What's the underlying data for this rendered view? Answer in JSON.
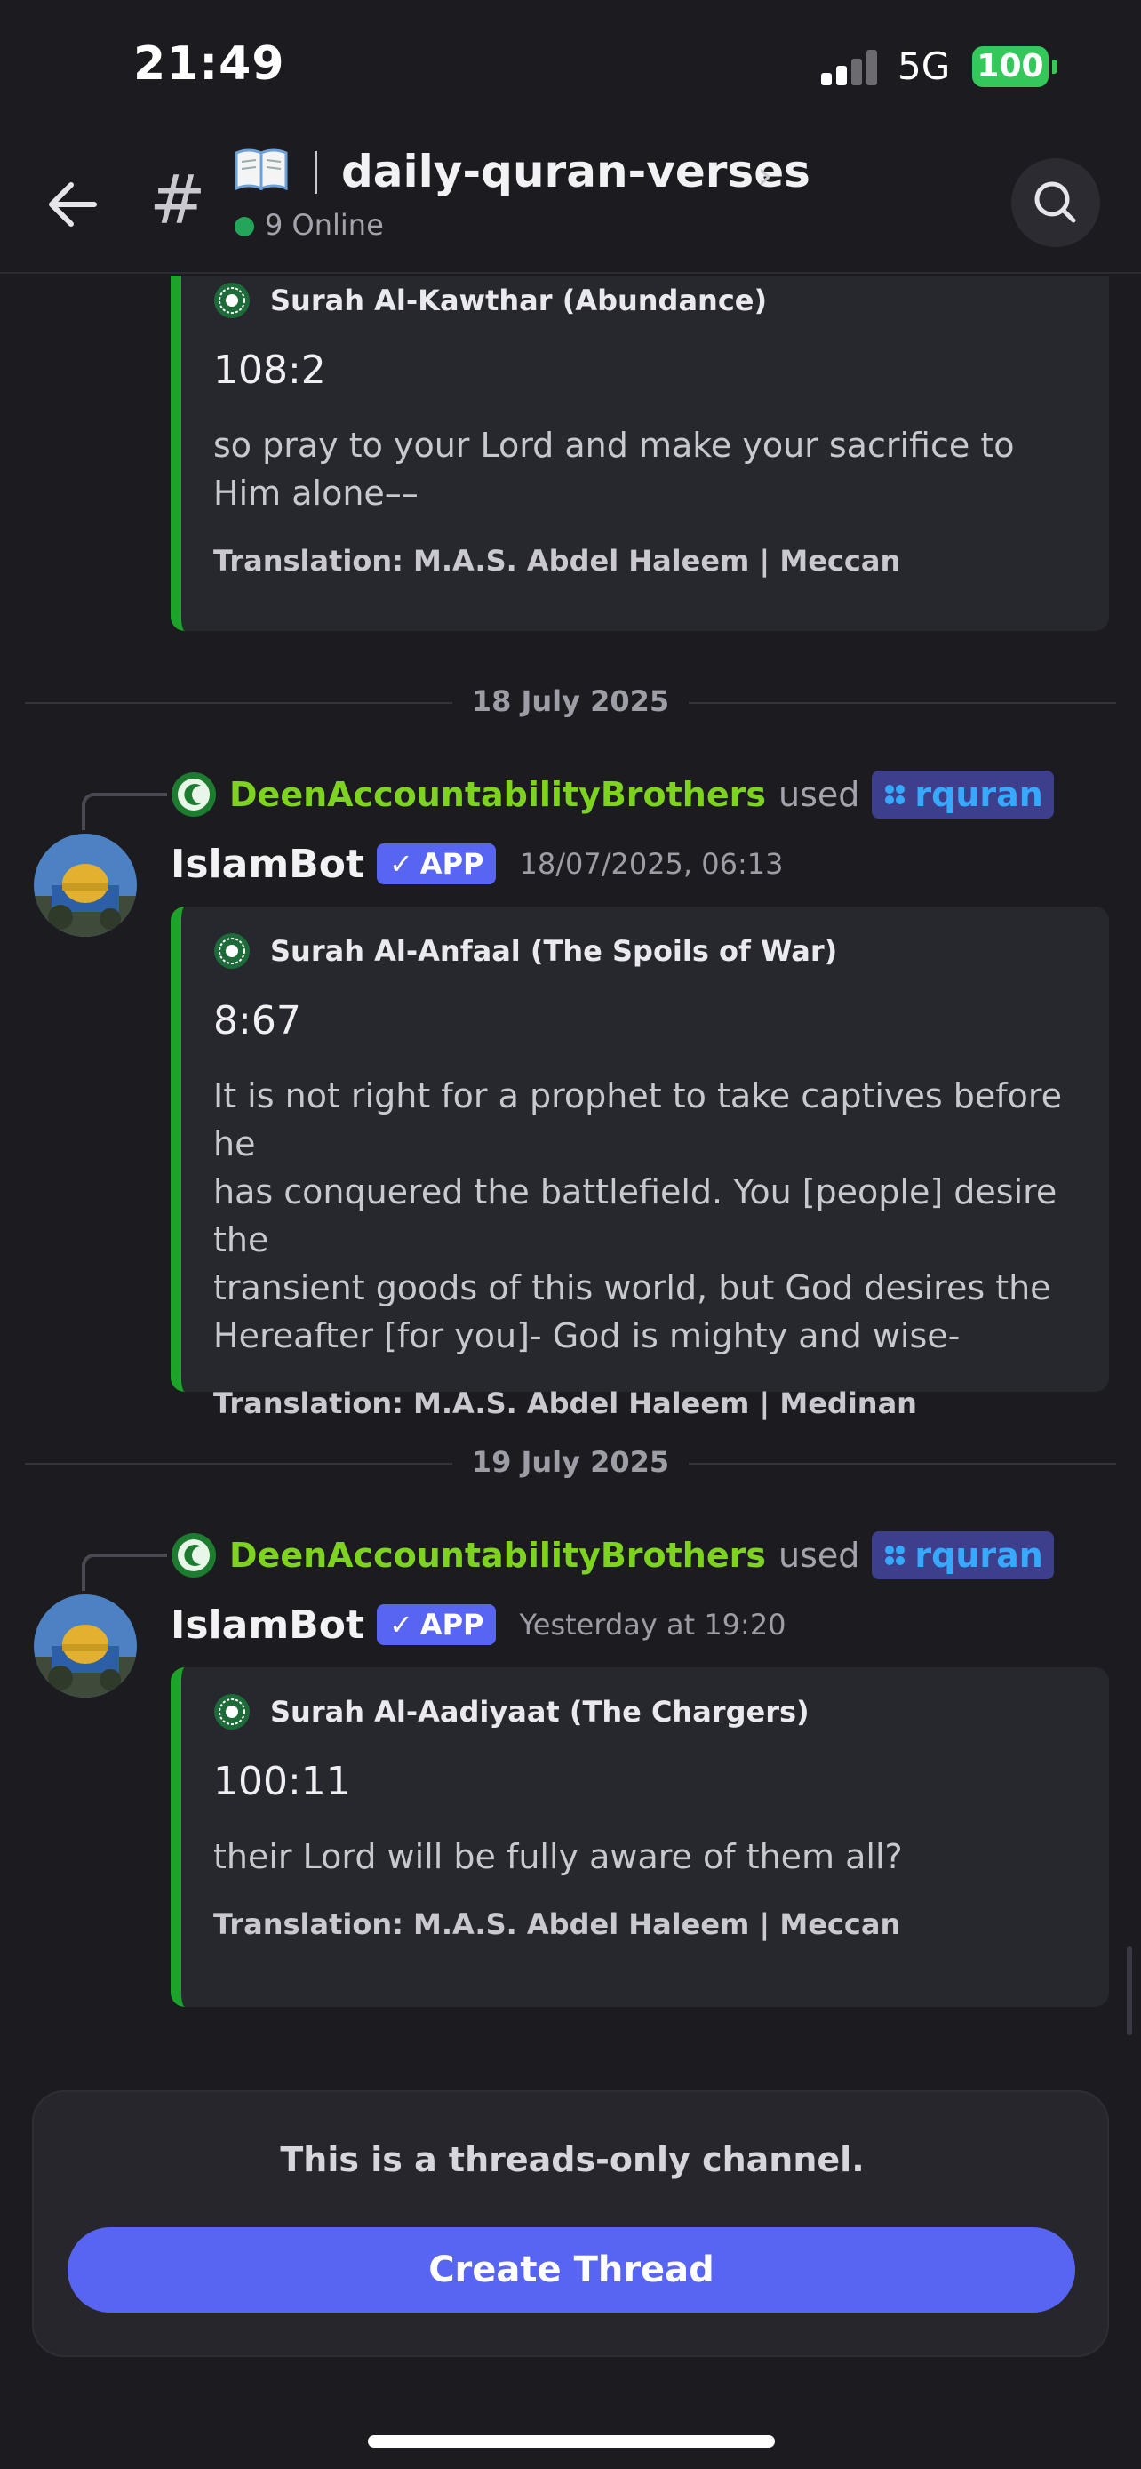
{
  "status_bar": {
    "time": "21:49",
    "network": "5G",
    "battery": "100"
  },
  "header": {
    "channel_emoji": "📖",
    "channel_name": "daily-quran-verses",
    "online_text": "9 Online",
    "icons": {
      "back": "arrow-left-icon",
      "channel": "hash-icon",
      "search": "search-icon",
      "chevron": "chevron-right-icon"
    }
  },
  "messages": [
    {
      "embed": {
        "author": "Surah Al-Kawthar (Abundance)",
        "verse": "108:2",
        "text": "so pray to your Lord and make your sacrifice to Him alone––",
        "footer": "Translation: M.A.S. Abdel Haleem | Meccan"
      }
    },
    {
      "date_separator": "18 July 2025",
      "reply_user": "DeenAccountabilityBrothers",
      "reply_used": "used",
      "command": "rquran",
      "bot_name": "IslamBot",
      "badge": "APP",
      "timestamp": "18/07/2025, 06:13",
      "embed": {
        "author": "Surah Al-Anfaal (The Spoils of War)",
        "verse": "8:67",
        "text_lines": [
          "It is not right for a prophet to take captives before he",
          "has conquered the battlefield. You [people] desire the",
          "transient goods of this world, but God desires the",
          "Hereafter [for you]- God is mighty and wise-"
        ],
        "footer": "Translation: M.A.S. Abdel Haleem | Medinan"
      }
    },
    {
      "date_separator": "19 July 2025",
      "reply_user": "DeenAccountabilityBrothers",
      "reply_used": "used",
      "command": "rquran",
      "bot_name": "IslamBot",
      "badge": "APP",
      "timestamp": "Yesterday at 19:20",
      "embed": {
        "author": "Surah Al-Aadiyaat (The Chargers)",
        "verse": "100:11",
        "text": "their Lord will be fully aware of them all?",
        "footer": "Translation: M.A.S. Abdel Haleem | Meccan"
      }
    }
  ],
  "thread_panel": {
    "notice": "This is a threads-only channel.",
    "button_label": "Create Thread"
  },
  "colors": {
    "background": "#1b1b20",
    "embed_bar": "#1ea32a",
    "blurple": "#5865f2",
    "user_green": "#7ed321",
    "command_blue": "#36a9ff",
    "online_green": "#23a55a"
  }
}
